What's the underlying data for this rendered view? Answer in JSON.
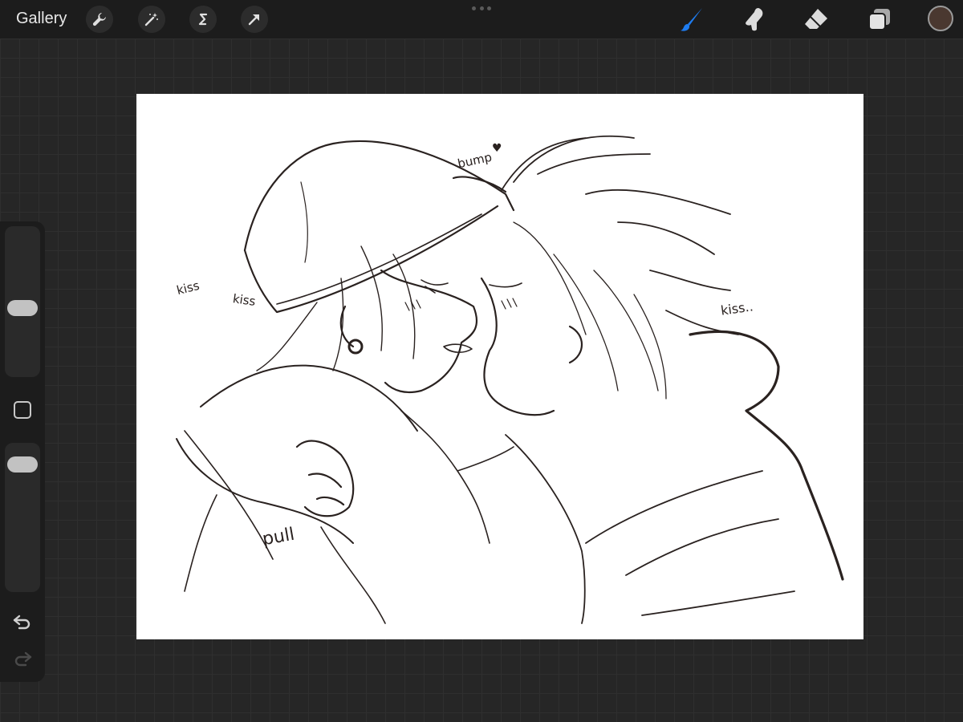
{
  "toolbar": {
    "gallery_label": "Gallery",
    "left_tools": [
      "wrench-icon",
      "magic-wand-icon",
      "selection-s-icon",
      "transform-arrow-icon"
    ],
    "right_tools": [
      "brush-icon",
      "smudge-icon",
      "eraser-icon",
      "layers-icon"
    ],
    "active_tool": "brush",
    "accent_color": "#1e7cf0",
    "current_color": "#4a3830"
  },
  "sidebar": {
    "brush_size_level": 0.45,
    "opacity_level": 0.92,
    "icons": [
      "modify-square-icon",
      "undo-icon",
      "redo-icon"
    ]
  },
  "canvas": {
    "background": "#ffffff",
    "ink_color": "#2a2220",
    "annotations": {
      "bump": "bump",
      "kiss_1": "kiss",
      "kiss_2": "kiss",
      "kiss_3": "kiss..",
      "pull": "pull"
    }
  }
}
